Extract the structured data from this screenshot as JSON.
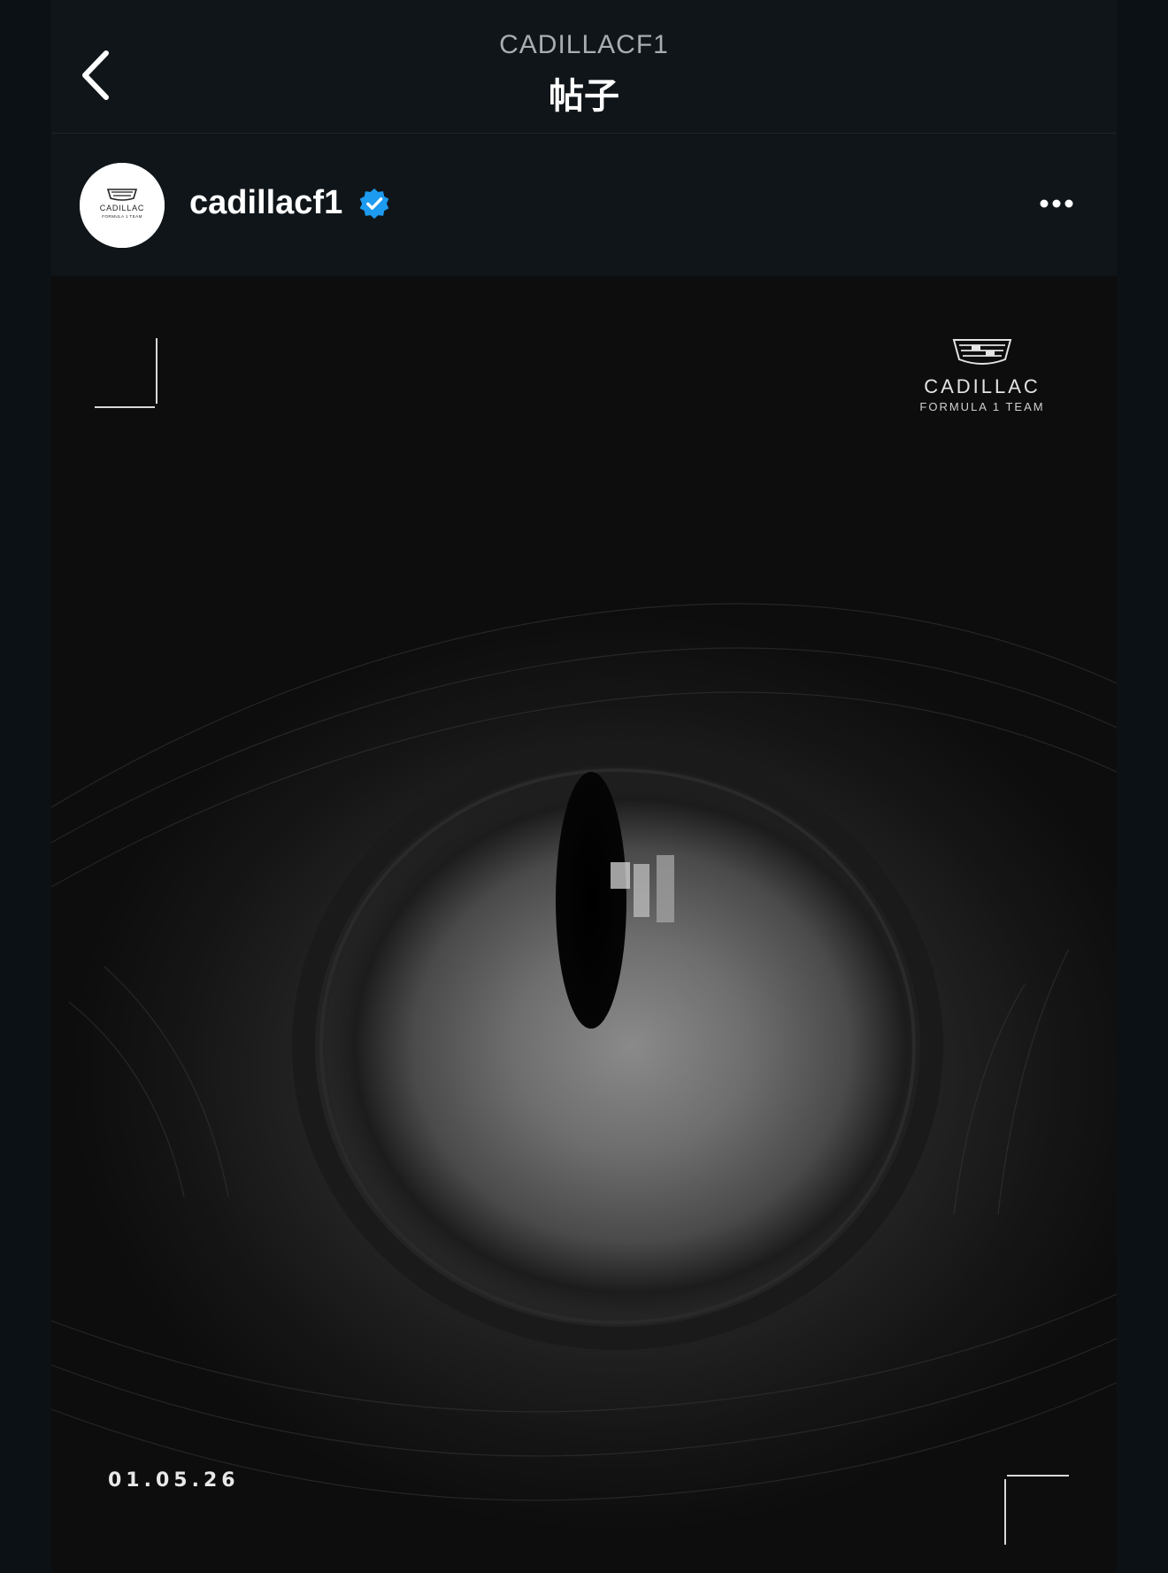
{
  "header": {
    "back_icon": "chevron-left-icon",
    "handle": "CADILLACF1",
    "title": "帖子"
  },
  "profile": {
    "username": "cadillacf1",
    "verified_icon": "verified-badge-icon",
    "verified_color": "#1d9bf0",
    "more_icon": "more-horizontal-icon",
    "avatar_logo_text": "CADILLAC",
    "avatar_logo_subtext": "FORMULA 1 TEAM"
  },
  "post": {
    "brand_name": "CADILLAC",
    "brand_sub": "FORMULA 1 TEAM",
    "date_text": "01.05.26"
  },
  "colors": {
    "background": "#0f1519",
    "text_primary": "#ffffff",
    "text_secondary": "#a7adb1"
  }
}
